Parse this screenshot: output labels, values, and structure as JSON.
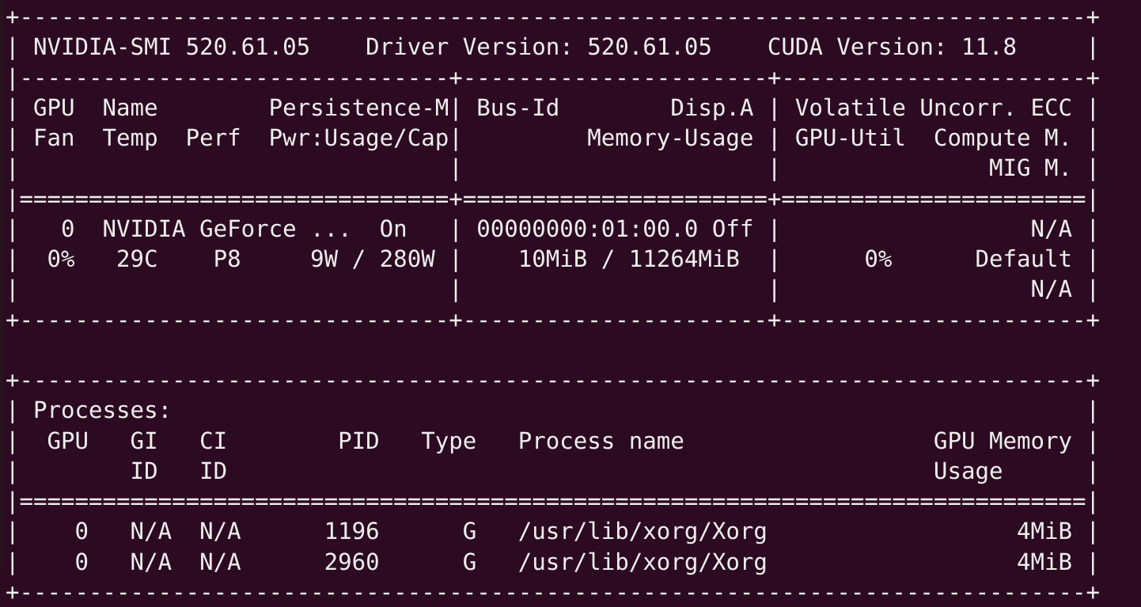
{
  "app": {
    "name": "nvidia-smi",
    "window_kind": "terminal",
    "background_color": "#2c0a22",
    "foreground_color": "#eeeeec",
    "gutter_color": "#27141f"
  },
  "summary": {
    "nvidia_smi_label": "NVIDIA-SMI",
    "nvidia_smi_version": "520.61.05",
    "driver_version_label": "Driver Version:",
    "driver_version": "520.61.05",
    "cuda_version_label": "CUDA Version:",
    "cuda_version": "11.8"
  },
  "gpu_table": {
    "headers_row1": [
      "GPU",
      "Name",
      "Persistence-M",
      "Bus-Id",
      "Disp.A",
      "Volatile Uncorr. ECC"
    ],
    "headers_row2": [
      "Fan",
      "Temp",
      "Perf",
      "Pwr:Usage/Cap",
      "Memory-Usage",
      "GPU-Util",
      "Compute M."
    ],
    "headers_row3": [
      "MIG M."
    ],
    "rows": [
      {
        "gpu": "0",
        "name": "NVIDIA GeForce ...",
        "persistence_m": "On",
        "bus_id": "00000000:01:00.0",
        "disp_a": "Off",
        "ecc": "N/A",
        "fan": "0%",
        "temp": "29C",
        "perf": "P8",
        "pwr_usage": "9W",
        "pwr_cap": "280W",
        "pwr_combined": "9W / 280W",
        "mem_used": "10MiB",
        "mem_total": "11264MiB",
        "mem_combined": "10MiB / 11264MiB",
        "gpu_util": "0%",
        "compute_m": "Default",
        "mig_m": "N/A"
      }
    ]
  },
  "processes_table": {
    "title": "Processes:",
    "headers_row1": [
      "GPU",
      "GI",
      "CI",
      "PID",
      "Type",
      "Process name",
      "GPU Memory"
    ],
    "headers_row2": [
      "ID",
      "ID",
      "Usage"
    ],
    "rows": [
      {
        "gpu": "0",
        "gi_id": "N/A",
        "ci_id": "N/A",
        "pid": "1196",
        "type": "G",
        "process_name": "/usr/lib/xorg/Xorg",
        "gpu_memory_usage": "4MiB"
      },
      {
        "gpu": "0",
        "gi_id": "N/A",
        "ci_id": "N/A",
        "pid": "2960",
        "type": "G",
        "process_name": "/usr/lib/xorg/Xorg",
        "gpu_memory_usage": "4MiB"
      }
    ]
  },
  "rendered_lines": [
    "+-----------------------------------------------------------------------------+",
    "| NVIDIA-SMI 520.61.05    Driver Version: 520.61.05    CUDA Version: 11.8     |",
    "|-------------------------------+----------------------+----------------------+",
    "| GPU  Name        Persistence-M| Bus-Id        Disp.A | Volatile Uncorr. ECC |",
    "| Fan  Temp  Perf  Pwr:Usage/Cap|         Memory-Usage | GPU-Util  Compute M. |",
    "|                               |                      |               MIG M. |",
    "|===============================+======================+======================|",
    "|   0  NVIDIA GeForce ...  On   | 00000000:01:00.0 Off |                  N/A |",
    "|  0%   29C    P8     9W / 280W |    10MiB / 11264MiB  |      0%      Default |",
    "|                               |                      |                  N/A |",
    "+-------------------------------+----------------------+----------------------+",
    "",
    "+-----------------------------------------------------------------------------+",
    "| Processes:                                                                  |",
    "|  GPU   GI   CI        PID   Type   Process name                  GPU Memory |",
    "|        ID   ID                                                   Usage      |",
    "|=============================================================================|",
    "|    0   N/A  N/A      1196      G   /usr/lib/xorg/Xorg                  4MiB |",
    "|    0   N/A  N/A      2960      G   /usr/lib/xorg/Xorg                  4MiB |",
    "+-----------------------------------------------------------------------------+"
  ]
}
